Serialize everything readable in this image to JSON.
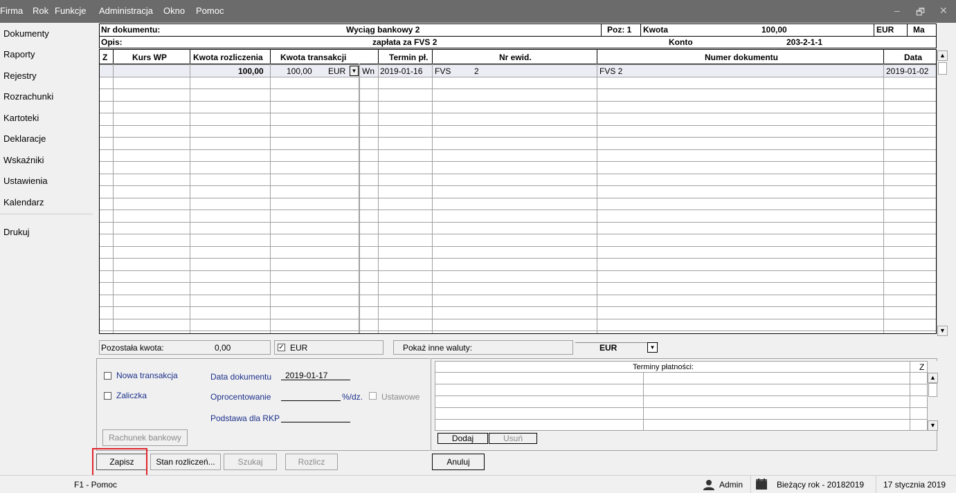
{
  "menu": [
    "Firma",
    "Rok",
    "Funkcje",
    "Administracja",
    "Okno",
    "Pomoc"
  ],
  "window_controls": {
    "minimize": "–",
    "restore": "🗗",
    "close": "✕"
  },
  "sidebar": {
    "items": [
      "Dokumenty",
      "Raporty",
      "Rejestry",
      "Rozrachunki",
      "Kartoteki",
      "Deklaracje",
      "Wskaźniki",
      "Ustawienia",
      "Kalendarz"
    ],
    "extra": "Drukuj"
  },
  "header": {
    "nr_label": "Nr dokumentu:",
    "doc_name": "Wyciąg bankowy 2",
    "poz_label": "Poz: 1",
    "kwota_label": "Kwota",
    "kwota_value": "100,00",
    "currency": "EUR",
    "side": "Ma",
    "opis_label": "Opis:",
    "opis_value": "zapłata za FVS 2",
    "konto_label": "Konto",
    "konto_value": "203-2-1-1"
  },
  "table": {
    "columns": [
      "Z",
      "Kurs WP",
      "Kwota rozliczenia",
      "Kwota transakcji",
      "Termin pł.",
      "Nr ewid.",
      "Numer dokumentu",
      "Data"
    ],
    "rows": [
      {
        "z": "",
        "kurs": "",
        "kwota_rozl": "100,00",
        "kwota_trans": "100,00",
        "waluta": "EUR",
        "wn": "Wn",
        "termin": "2019-01-16",
        "nr_ewid_prefix": "FVS",
        "nr_ewid_num": "2",
        "numer_dok": "FVS 2",
        "data": "2019-01-02"
      }
    ]
  },
  "summary": {
    "pozostala_label": "Pozostała kwota:",
    "pozostala_value": "0,00",
    "eur_checkbox_label": "EUR",
    "pokaz_label": "Pokaż inne waluty:",
    "currency_select": "EUR"
  },
  "form": {
    "nowa_transakcja": "Nowa transakcja",
    "zaliczka": "Zaliczka",
    "data_dok_label": "Data dokumentu",
    "data_dok_value": "2019-01-17",
    "oprocentowanie_label": "Oprocentowanie",
    "oprocentowanie_unit": "%/dz.",
    "ustawowe_label": "Ustawowe",
    "podstawa_label": "Podstawa dla RKP",
    "rachunek_button": "Rachunek bankowy"
  },
  "terminy": {
    "header": "Terminy płatności:",
    "z_header": "Z",
    "dodaj": "Dodaj",
    "usun": "Usuń"
  },
  "buttons": {
    "zapisz": "Zapisz",
    "stan": "Stan rozliczeń...",
    "szukaj": "Szukaj",
    "rozlicz": "Rozlicz",
    "anuluj": "Anuluj"
  },
  "status": {
    "help": "F1 - Pomoc",
    "user": "Admin",
    "year": "Bieżący rok - 20182019",
    "date": "17 stycznia 2019"
  },
  "colors": {
    "menubar": "#6b6b6b",
    "highlight_box": "#e0242b",
    "selected_row": "#ececf4"
  }
}
